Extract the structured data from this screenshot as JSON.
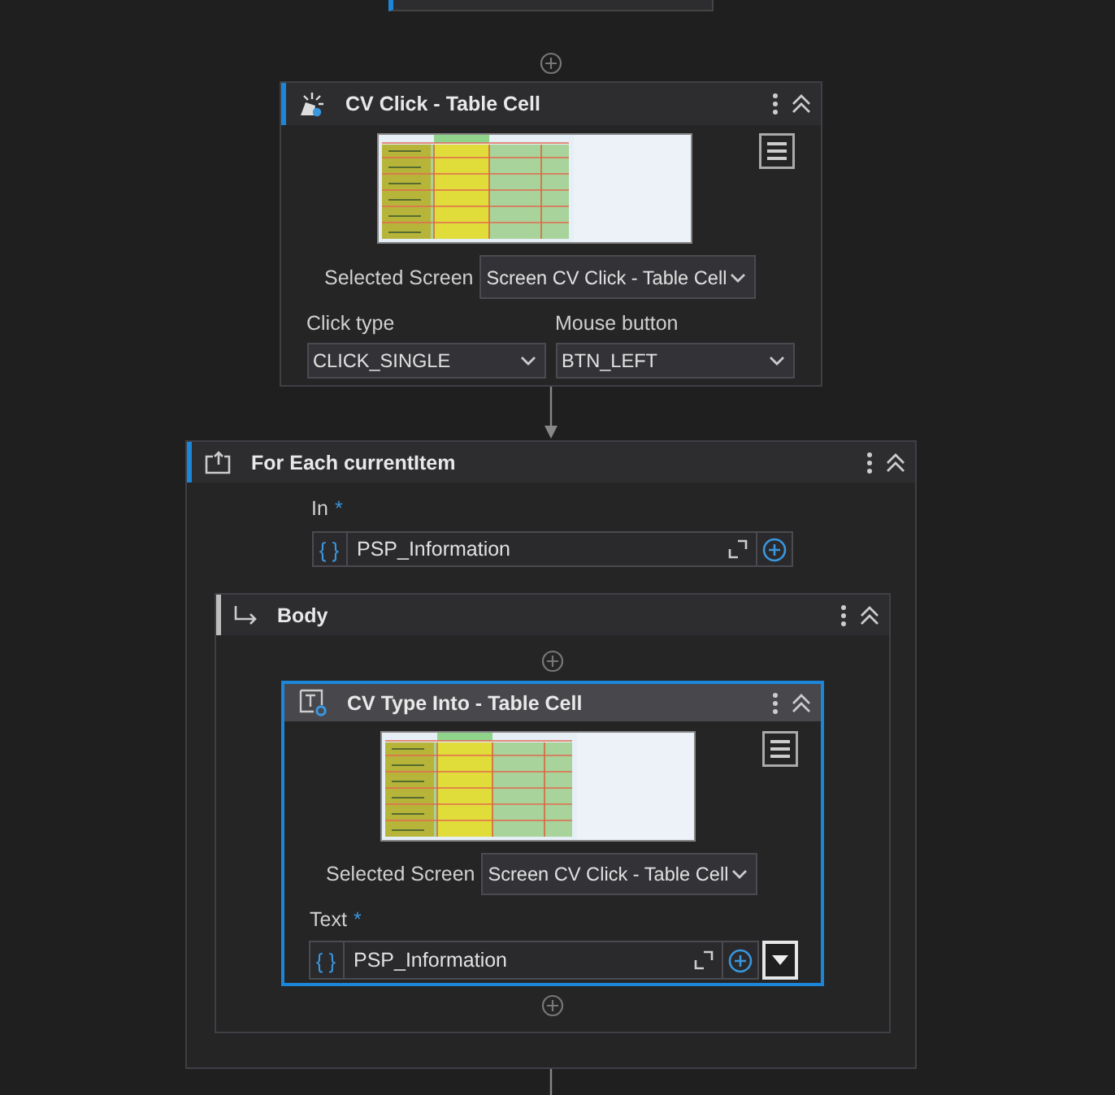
{
  "click_activity": {
    "title": "CV Click - Table Cell",
    "selected": false,
    "selected_screen": {
      "label": "Selected Screen",
      "value": "Screen CV Click - Table Cell"
    },
    "click_type": {
      "label": "Click type",
      "value": "CLICK_SINGLE"
    },
    "mouse_button": {
      "label": "Mouse button",
      "value": "BTN_LEFT"
    }
  },
  "for_each": {
    "title": "For Each currentItem",
    "selected": false,
    "in_field": {
      "label": "In",
      "required_mark": "*",
      "braces": "{ }",
      "value": "PSP_Information"
    },
    "body": {
      "title": "Body",
      "activity": {
        "title": "CV Type Into - Table Cell",
        "selected": true,
        "selected_screen": {
          "label": "Selected Screen",
          "value": "Screen CV Click - Table Cell"
        },
        "text_field": {
          "label": "Text",
          "required_mark": "*",
          "braces": "{ }",
          "value": "PSP_Information"
        }
      }
    }
  }
}
